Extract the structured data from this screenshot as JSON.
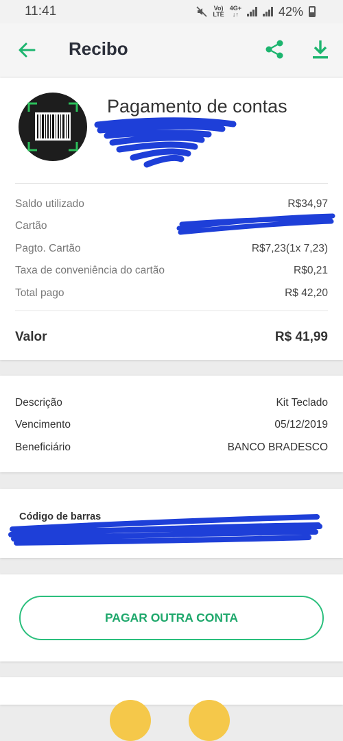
{
  "status_bar": {
    "time": "11:41",
    "volte_line1": "Vo)",
    "volte_line2": "LTE",
    "net_line1": "4G+",
    "net_line2": "↓↑",
    "battery": "42%"
  },
  "header": {
    "title": "Recibo",
    "icons": [
      "back-arrow-icon",
      "share-icon",
      "download-icon"
    ],
    "accent_color": "#1db56f"
  },
  "payment": {
    "title": "Pagamento de contas",
    "icon": "barcode-scan-icon",
    "details": [
      {
        "label": "Saldo utilizado",
        "value": "R$34,97"
      },
      {
        "label": "Cartão",
        "value": ""
      },
      {
        "label": "Pagto. Cartão",
        "value": "R$7,23(1x 7,23)"
      },
      {
        "label": "Taxa de conveniência do cartão",
        "value": "R$0,21"
      },
      {
        "label": "Total pago",
        "value": "R$ 42,20"
      }
    ],
    "valor_label": "Valor",
    "valor_value": "R$ 41,99"
  },
  "bill": {
    "rows": [
      {
        "label": "Descrição",
        "value": "Kit Teclado"
      },
      {
        "label": "Vencimento",
        "value": "05/12/2019"
      },
      {
        "label": "Beneficiário",
        "value": "BANCO BRADESCO"
      }
    ]
  },
  "barcode": {
    "label": "Código de barras"
  },
  "actions": {
    "pay_another": "PAGAR OUTRA CONTA"
  },
  "redaction_color": "#1e3fd8"
}
